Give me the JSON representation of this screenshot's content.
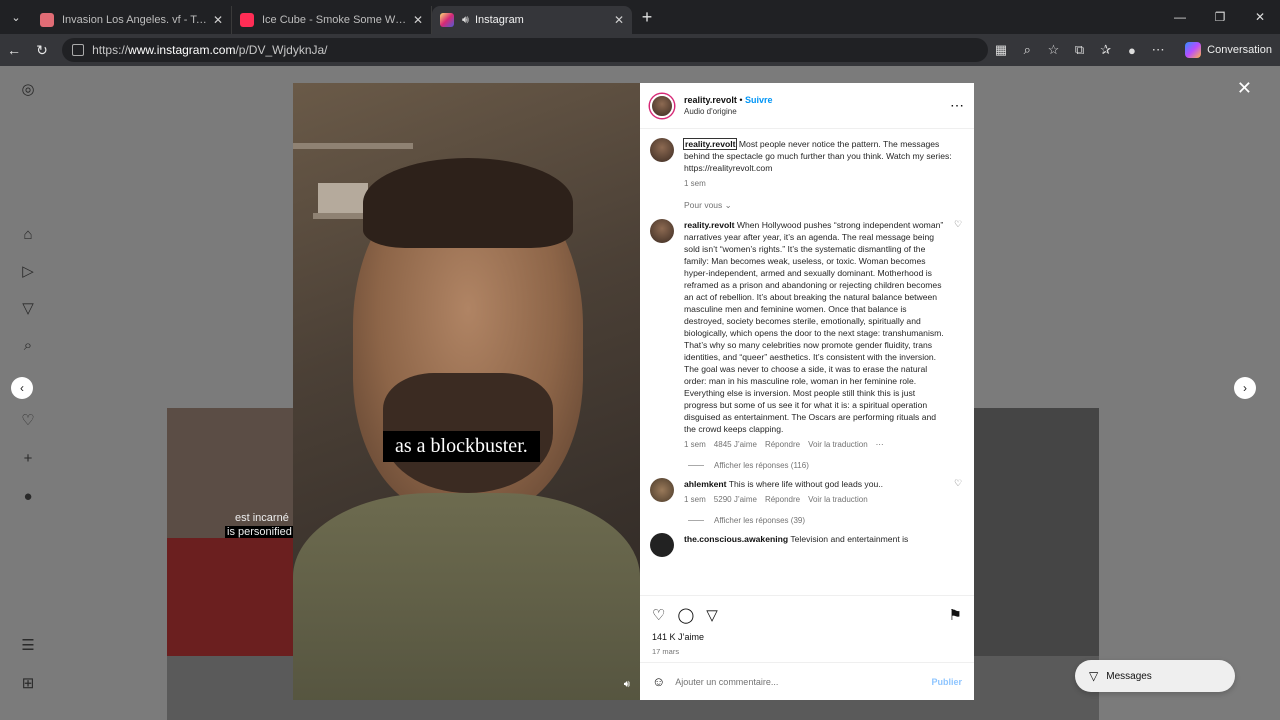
{
  "browser": {
    "tabs": [
      {
        "title": "Invasion Los Angeles. vf - TokyVid",
        "color": "#e06c75"
      },
      {
        "title": "Ice Cube - Smoke Some Weed (Di",
        "color": "#ff2d55"
      },
      {
        "title": "Instagram",
        "color": "#d62976",
        "active": true
      }
    ],
    "url_prefix": "https://",
    "url_host": "www.instagram.com",
    "url_path": "/p/DV_WjdyknJa/",
    "conversation_label": "Conversation"
  },
  "post": {
    "username": "reality.revolt",
    "follow_label": "Suivre",
    "audio": "Audio d'origine",
    "subtitle": "as a blockbuster.",
    "caption": "Most people never notice the pattern. The messages behind the spectacle go much further than you think. Watch my series: https://realityrevolt.com",
    "caption_time": "1 sem",
    "pour_vous": "Pour vous",
    "comments": [
      {
        "user": "reality.revolt",
        "text": "When Hollywood pushes “strong independent woman” narratives year after year, it’s an agenda. The real message being sold isn’t “women’s rights.” It’s the systematic dismantling of the family: Man becomes weak, useless, or toxic. Woman becomes hyper-independent, armed and sexually dominant. Motherhood is reframed as a prison and abandoning or rejecting children becomes an act of rebellion. It’s about breaking the natural balance between masculine men and feminine women. Once that balance is destroyed, society becomes sterile, emotionally, spiritually and biologically, which opens the door to the next stage: transhumanism. That’s why so many celebrities now promote gender fluidity, trans identities, and “queer” aesthetics. It’s consistent with the inversion. The goal was never to choose a side, it was to erase the natural order: man in his masculine role, woman in her feminine role. Everything else is inversion. Most people still think this is just progress but some of us see it for what it is: a spiritual operation disguised as entertainment. The Oscars are performing rituals and the crowd keeps clapping.",
        "time": "1 sem",
        "likes": "4845 J’aime",
        "reply": "Répondre",
        "translate": "Voir la traduction",
        "replies": "Afficher les réponses (116)"
      },
      {
        "user": "ahlemkent",
        "text": "This is where life without god leads you..",
        "time": "1 sem",
        "likes": "5290 J’aime",
        "reply": "Répondre",
        "translate": "Voir la traduction",
        "replies": "Afficher les réponses (39)"
      },
      {
        "user": "the.conscious.awakening",
        "text": "Television and entertainment is"
      }
    ],
    "likes_total": "141 K J’aime",
    "date": "17 mars",
    "add_comment_placeholder": "Ajouter un commentaire...",
    "publish_label": "Publier"
  },
  "background": {
    "cap1": "est incarné",
    "cap2": "is personified"
  },
  "messages_label": "Messages"
}
